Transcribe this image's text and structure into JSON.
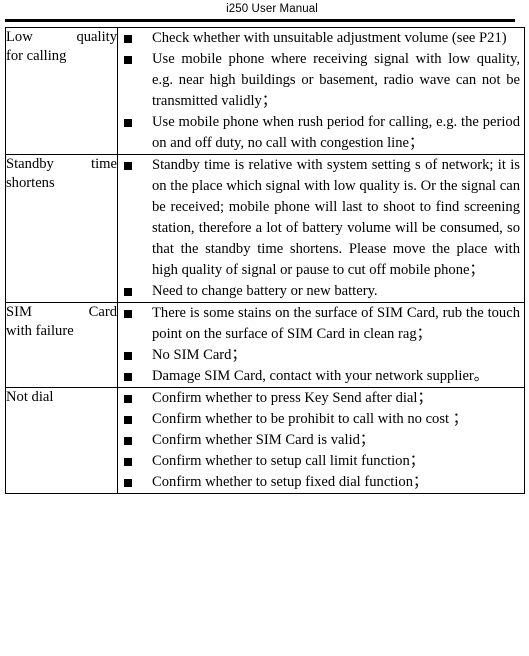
{
  "header": {
    "title": "i250 User Manual"
  },
  "table": {
    "rows": [
      {
        "symptom_line1": "Low quality",
        "symptom_line2": "for calling",
        "symptom_full": "Low quality for calling",
        "solutions": [
          "Check whether with unsuitable adjustment volume (see P21)",
          "Use mobile phone where receiving signal with low quality, e.g. near high buildings or basement, radio wave can not be transmitted validly；",
          "Use mobile phone when rush period for calling, e.g. the period on and off duty, no call with congestion line；"
        ]
      },
      {
        "symptom_line1": "Standby time",
        "symptom_line2": "shortens",
        "symptom_full": "Standby time shortens",
        "solutions": [
          "Standby time is relative with system setting s of network; it is on the place which signal with low quality is. Or the signal can be received; mobile phone will last to shoot to find screening station, therefore a lot of battery volume will be consumed, so that the standby time shortens. Please move the place with high quality of signal or pause to cut off mobile phone；",
          "Need to change battery or new battery."
        ]
      },
      {
        "symptom_line1": "SIM Card",
        "symptom_line2": "with failure",
        "symptom_full": "SIM Card with failure",
        "solutions": [
          "There is some stains on the surface of SIM Card, rub the touch point on the surface of SIM Card in clean rag；",
          "No SIM Card；",
          "Damage SIM Card, contact with your network supplier。"
        ]
      },
      {
        "symptom_line1": "Not dial",
        "symptom_line2": "",
        "symptom_full": "Not dial",
        "solutions": [
          "Confirm whether to press Key Send after dial；",
          "Confirm whether to be prohibit to call with no cost  ；",
          "Confirm whether SIM Card is valid；",
          "Confirm whether to setup call limit function；",
          "Confirm whether to setup fixed dial function；"
        ]
      }
    ]
  }
}
